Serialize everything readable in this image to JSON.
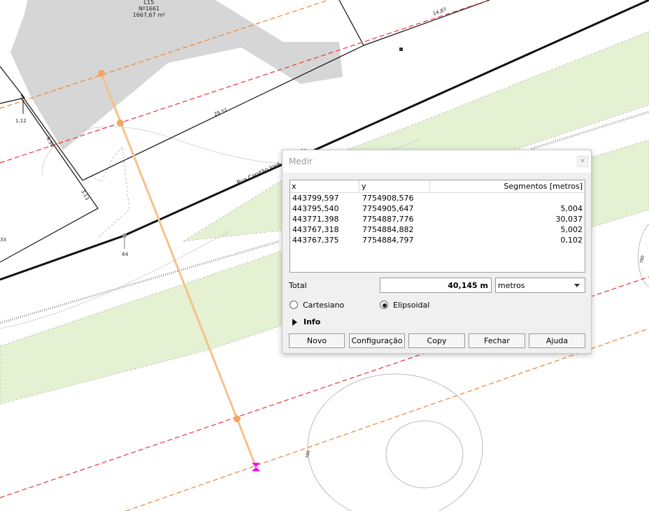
{
  "dialog": {
    "title": "Medir",
    "close_icon": "close-icon",
    "columns": {
      "x": "x",
      "y": "y",
      "segments": "Segmentos [metros]"
    },
    "rows": [
      {
        "x": "443799,597",
        "y": "7754908,576",
        "segment": ""
      },
      {
        "x": "443795,540",
        "y": "7754905,647",
        "segment": "5,004"
      },
      {
        "x": "443771,398",
        "y": "7754887,776",
        "segment": "30,037"
      },
      {
        "x": "443767,318",
        "y": "7754884,882",
        "segment": "5,002"
      },
      {
        "x": "443767,375",
        "y": "7754884,797",
        "segment": "0,102"
      }
    ],
    "total_label": "Total",
    "total_value": "40,145 m",
    "unit_selected": "metros",
    "radio_cartesian": "Cartesiano",
    "radio_ellipsoidal": "Elipsoidal",
    "ellipsoidal_selected": true,
    "info_label": "Info",
    "buttons": {
      "novo": "Novo",
      "configuracao": "Configuração",
      "copy": "Copy",
      "fechar": "Fechar",
      "ajuda": "Ajuda"
    }
  },
  "map": {
    "lot_name": "L15",
    "lot_number": "Nº1661",
    "lot_area": "1667,67 m²",
    "dim_1487": "14,87",
    "dim_2951": "29,51",
    "dim_112": "1,12",
    "dim_930": "9,30",
    "dim_313": "3,13",
    "dim_33": "33",
    "street_name": "Rua Capitão José A",
    "street_suffix": "10",
    "point_label": "64",
    "contour_a": "780",
    "contour_b": "780",
    "colors": {
      "parcel_fill": "#d6d6d6",
      "green_strip": "#e4f1d2",
      "red_dashed": "#e8333a",
      "orange_dashed": "#f0822e",
      "measure_line": "#f4c28a",
      "vertex": "#f0a860",
      "end_marker": "#ff00ff"
    }
  }
}
